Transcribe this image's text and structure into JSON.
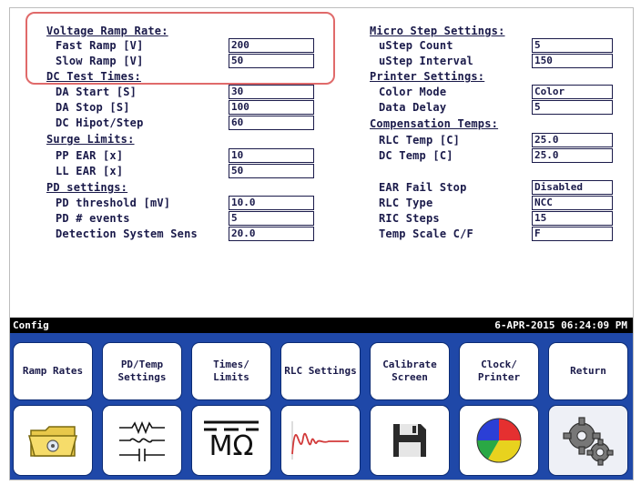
{
  "voltage_ramp": {
    "header": "Voltage Ramp Rate:",
    "fast_label": "Fast Ramp [V]",
    "fast_value": "200",
    "slow_label": "Slow Ramp [V]",
    "slow_value": "50"
  },
  "dc_test_times": {
    "header": "DC Test Times:",
    "da_start_label": "DA Start [S]",
    "da_start_value": "30",
    "da_stop_label": "DA Stop  [S]",
    "da_stop_value": "100",
    "dc_hipot_label": "DC Hipot/Step",
    "dc_hipot_value": "60"
  },
  "surge_limits": {
    "header": "Surge Limits:",
    "pp_ear_label": "PP EAR [x]",
    "pp_ear_value": "10",
    "ll_ear_label": "LL EAR [x]",
    "ll_ear_value": "50"
  },
  "pd_settings": {
    "header": "PD settings:",
    "threshold_label": "PD threshold [mV]",
    "threshold_value": "10.0",
    "events_label": "PD # events",
    "events_value": "5",
    "detection_label": "Detection System Sens",
    "detection_value": "20.0"
  },
  "micro_step": {
    "header": "Micro Step Settings:",
    "count_label": "uStep Count",
    "count_value": "5",
    "interval_label": "uStep Interval",
    "interval_value": "150"
  },
  "printer": {
    "header": "Printer Settings:",
    "color_label": "Color Mode",
    "color_value": "Color",
    "delay_label": "Data Delay",
    "delay_value": "5"
  },
  "compensation": {
    "header": "Compensation Temps:",
    "rlc_label": "RLC Temp [C]",
    "rlc_value": "25.0",
    "dc_label": "DC Temp  [C]",
    "dc_value": "25.0"
  },
  "misc": {
    "ear_fail_label": "EAR Fail Stop",
    "ear_fail_value": "Disabled",
    "rlc_type_label": "RLC Type",
    "rlc_type_value": "NCC",
    "ric_steps_label": "RIC Steps",
    "ric_steps_value": "15",
    "temp_scale_label": "Temp Scale C/F",
    "temp_scale_value": "F"
  },
  "status_bar": {
    "mode": "Config",
    "datetime": "6-APR-2015 06:24:09 PM"
  },
  "buttons": {
    "ramp_rates": "Ramp Rates",
    "pd_temp": "PD/Temp Settings",
    "times_limits": "Times/ Limits",
    "rlc_settings": "RLC Settings",
    "calibrate_screen": "Calibrate Screen",
    "clock_printer": "Clock/ Printer",
    "return": "Return"
  },
  "icon_glyphs": {
    "megohm": "MΩ"
  },
  "icons": [
    "folder-icon",
    "circuit-icon",
    "megohm-icon",
    "waveform-icon",
    "save-icon",
    "pie-chart-icon",
    "gears-icon"
  ],
  "colors": {
    "panel_blue": "#1f48a8",
    "highlight": "#e06a6a",
    "text": "#1a1a4a",
    "status_bar": "#000000"
  }
}
